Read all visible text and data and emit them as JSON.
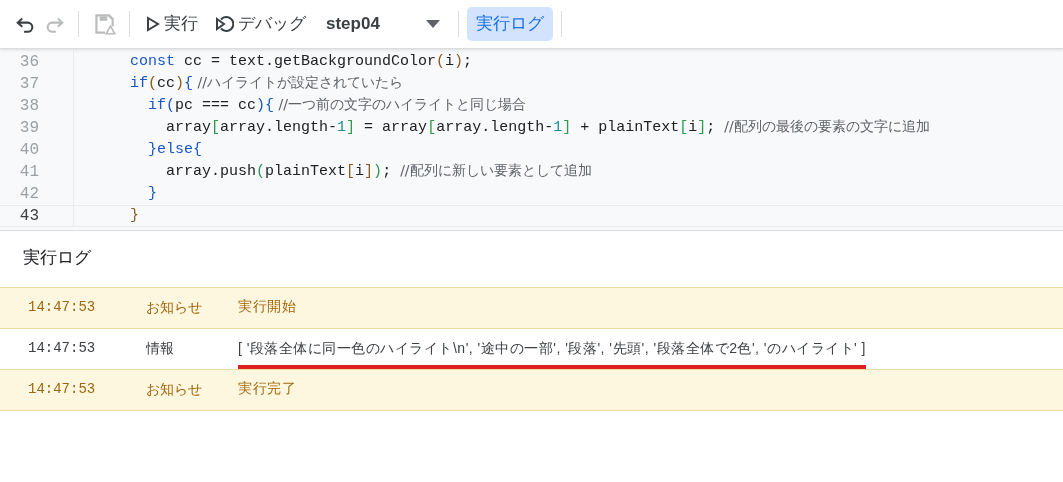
{
  "toolbar": {
    "undo": {
      "disabled": false
    },
    "redo": {
      "disabled": true
    },
    "save": {
      "disabled": true
    },
    "run": {
      "label": "実行"
    },
    "debug": {
      "label": "デバッグ"
    },
    "function_select": {
      "value": "step04"
    },
    "log_toggle": {
      "label": "実行ログ",
      "selected": true
    }
  },
  "editor": {
    "lines": [
      {
        "number": "36",
        "current": false,
        "tokens": [
          {
            "text": "  const",
            "kind": "keyword"
          },
          {
            "text": " cc = text.getBackgroundColor",
            "kind": "plain"
          },
          {
            "text": "(",
            "kind": "paren"
          },
          {
            "text": "i",
            "kind": "plain"
          },
          {
            "text": ")",
            "kind": "paren"
          },
          {
            "text": ";",
            "kind": "plain"
          }
        ]
      },
      {
        "number": "37",
        "current": false,
        "tokens": [
          {
            "text": "  if",
            "kind": "keyword"
          },
          {
            "text": "(",
            "kind": "paren"
          },
          {
            "text": "cc",
            "kind": "plain"
          },
          {
            "text": ")",
            "kind": "paren"
          },
          {
            "text": "{",
            "kind": "brace"
          },
          {
            "text": " //ハイライトが設定されていたら",
            "kind": "comment"
          }
        ]
      },
      {
        "number": "38",
        "current": false,
        "tokens": [
          {
            "text": "    if",
            "kind": "keyword"
          },
          {
            "text": "(",
            "kind": "brace"
          },
          {
            "text": "pc === cc",
            "kind": "plain"
          },
          {
            "text": ")",
            "kind": "brace"
          },
          {
            "text": "{",
            "kind": "brace"
          },
          {
            "text": " //一つ前の文字のハイライトと同じ場合",
            "kind": "comment"
          }
        ]
      },
      {
        "number": "39",
        "current": false,
        "tokens": [
          {
            "text": "      array",
            "kind": "plain"
          },
          {
            "text": "[",
            "kind": "bracket"
          },
          {
            "text": "array.length-",
            "kind": "plain"
          },
          {
            "text": "1",
            "kind": "number"
          },
          {
            "text": "]",
            "kind": "bracket"
          },
          {
            "text": " = array",
            "kind": "plain"
          },
          {
            "text": "[",
            "kind": "bracket"
          },
          {
            "text": "array.length-",
            "kind": "plain"
          },
          {
            "text": "1",
            "kind": "number"
          },
          {
            "text": "]",
            "kind": "bracket"
          },
          {
            "text": " + plainText",
            "kind": "plain"
          },
          {
            "text": "[",
            "kind": "bracket"
          },
          {
            "text": "i",
            "kind": "plain"
          },
          {
            "text": "]",
            "kind": "bracket"
          },
          {
            "text": "; ",
            "kind": "plain"
          },
          {
            "text": "//配列の最後の要素の文字に追加",
            "kind": "comment"
          }
        ]
      },
      {
        "number": "40",
        "current": false,
        "tokens": [
          {
            "text": "    }else{",
            "kind": "brace"
          }
        ]
      },
      {
        "number": "41",
        "current": false,
        "tokens": [
          {
            "text": "      array.push",
            "kind": "plain"
          },
          {
            "text": "(",
            "kind": "bracket"
          },
          {
            "text": "plainText",
            "kind": "plain"
          },
          {
            "text": "[",
            "kind": "paren"
          },
          {
            "text": "i",
            "kind": "plain"
          },
          {
            "text": "]",
            "kind": "paren"
          },
          {
            "text": ")",
            "kind": "bracket"
          },
          {
            "text": "; ",
            "kind": "plain"
          },
          {
            "text": "//配列に新しい要素として追加",
            "kind": "comment"
          }
        ]
      },
      {
        "number": "42",
        "current": false,
        "tokens": [
          {
            "text": "    }",
            "kind": "brace"
          }
        ]
      },
      {
        "number": "43",
        "current": true,
        "tokens": [
          {
            "text": "  }",
            "kind": "paren"
          }
        ]
      }
    ]
  },
  "log": {
    "title": "実行ログ",
    "rows": [
      {
        "kind": "notice",
        "time": "14:47:53",
        "level": "お知らせ",
        "message": "実行開始",
        "underlined": false
      },
      {
        "kind": "info",
        "time": "14:47:53",
        "level": "情報",
        "message": "[ '段落全体に同一色のハイライト\\n', '途中の一部', '段落', '先頭', '段落全体で2色', 'のハイライト' ]",
        "underlined": true
      },
      {
        "kind": "notice",
        "time": "14:47:53",
        "level": "お知らせ",
        "message": "実行完了",
        "underlined": false
      }
    ]
  }
}
